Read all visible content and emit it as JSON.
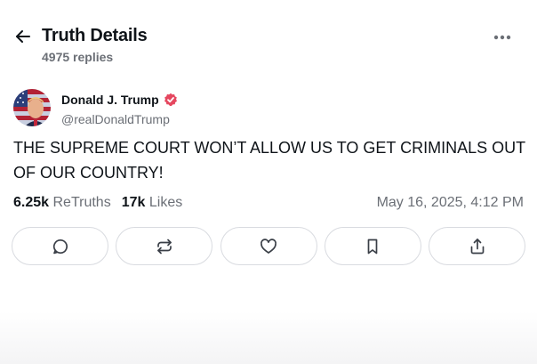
{
  "header": {
    "title": "Truth Details",
    "replies": "4975 replies"
  },
  "post": {
    "author_name": "Donald J. Trump",
    "handle": "@realDonaldTrump",
    "text": "THE SUPREME COURT WON’T ALLOW US TO GET CRIMINALS OUT OF OUR COUNTRY!",
    "retruths_count": "6.25k",
    "retruths_label": "ReTruths",
    "likes_count": "17k",
    "likes_label": "Likes",
    "timestamp": "May 16, 2025, 4:12 PM"
  },
  "actions": [
    "reply-icon",
    "retruth-icon",
    "heart-icon",
    "bookmark-icon",
    "share-icon"
  ],
  "colors": {
    "text": "#0f1419",
    "muted": "#6b6f76",
    "verified": "#e5475f",
    "border": "#d9dbe0"
  }
}
